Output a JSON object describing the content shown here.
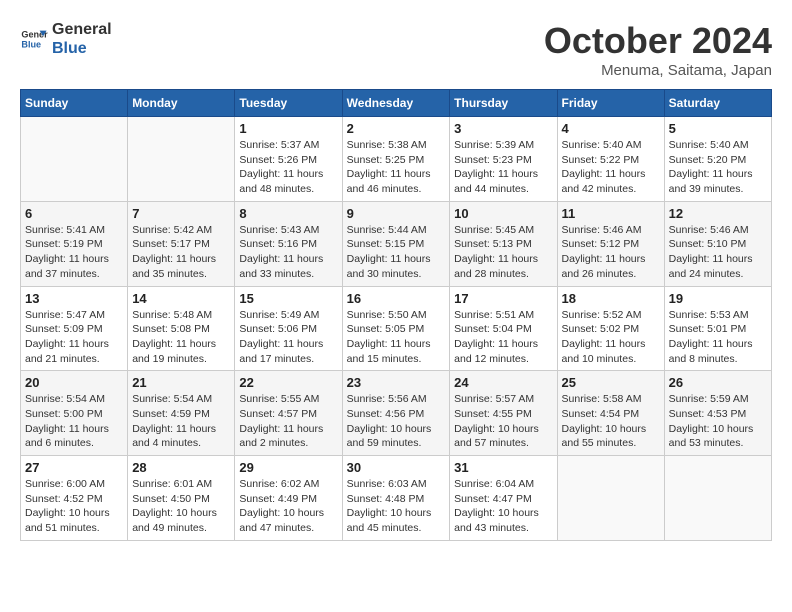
{
  "logo": {
    "line1": "General",
    "line2": "Blue"
  },
  "title": "October 2024",
  "subtitle": "Menuma, Saitama, Japan",
  "headers": [
    "Sunday",
    "Monday",
    "Tuesday",
    "Wednesday",
    "Thursday",
    "Friday",
    "Saturday"
  ],
  "weeks": [
    [
      {
        "day": "",
        "detail": ""
      },
      {
        "day": "",
        "detail": ""
      },
      {
        "day": "1",
        "detail": "Sunrise: 5:37 AM\nSunset: 5:26 PM\nDaylight: 11 hours and 48 minutes."
      },
      {
        "day": "2",
        "detail": "Sunrise: 5:38 AM\nSunset: 5:25 PM\nDaylight: 11 hours and 46 minutes."
      },
      {
        "day": "3",
        "detail": "Sunrise: 5:39 AM\nSunset: 5:23 PM\nDaylight: 11 hours and 44 minutes."
      },
      {
        "day": "4",
        "detail": "Sunrise: 5:40 AM\nSunset: 5:22 PM\nDaylight: 11 hours and 42 minutes."
      },
      {
        "day": "5",
        "detail": "Sunrise: 5:40 AM\nSunset: 5:20 PM\nDaylight: 11 hours and 39 minutes."
      }
    ],
    [
      {
        "day": "6",
        "detail": "Sunrise: 5:41 AM\nSunset: 5:19 PM\nDaylight: 11 hours and 37 minutes."
      },
      {
        "day": "7",
        "detail": "Sunrise: 5:42 AM\nSunset: 5:17 PM\nDaylight: 11 hours and 35 minutes."
      },
      {
        "day": "8",
        "detail": "Sunrise: 5:43 AM\nSunset: 5:16 PM\nDaylight: 11 hours and 33 minutes."
      },
      {
        "day": "9",
        "detail": "Sunrise: 5:44 AM\nSunset: 5:15 PM\nDaylight: 11 hours and 30 minutes."
      },
      {
        "day": "10",
        "detail": "Sunrise: 5:45 AM\nSunset: 5:13 PM\nDaylight: 11 hours and 28 minutes."
      },
      {
        "day": "11",
        "detail": "Sunrise: 5:46 AM\nSunset: 5:12 PM\nDaylight: 11 hours and 26 minutes."
      },
      {
        "day": "12",
        "detail": "Sunrise: 5:46 AM\nSunset: 5:10 PM\nDaylight: 11 hours and 24 minutes."
      }
    ],
    [
      {
        "day": "13",
        "detail": "Sunrise: 5:47 AM\nSunset: 5:09 PM\nDaylight: 11 hours and 21 minutes."
      },
      {
        "day": "14",
        "detail": "Sunrise: 5:48 AM\nSunset: 5:08 PM\nDaylight: 11 hours and 19 minutes."
      },
      {
        "day": "15",
        "detail": "Sunrise: 5:49 AM\nSunset: 5:06 PM\nDaylight: 11 hours and 17 minutes."
      },
      {
        "day": "16",
        "detail": "Sunrise: 5:50 AM\nSunset: 5:05 PM\nDaylight: 11 hours and 15 minutes."
      },
      {
        "day": "17",
        "detail": "Sunrise: 5:51 AM\nSunset: 5:04 PM\nDaylight: 11 hours and 12 minutes."
      },
      {
        "day": "18",
        "detail": "Sunrise: 5:52 AM\nSunset: 5:02 PM\nDaylight: 11 hours and 10 minutes."
      },
      {
        "day": "19",
        "detail": "Sunrise: 5:53 AM\nSunset: 5:01 PM\nDaylight: 11 hours and 8 minutes."
      }
    ],
    [
      {
        "day": "20",
        "detail": "Sunrise: 5:54 AM\nSunset: 5:00 PM\nDaylight: 11 hours and 6 minutes."
      },
      {
        "day": "21",
        "detail": "Sunrise: 5:54 AM\nSunset: 4:59 PM\nDaylight: 11 hours and 4 minutes."
      },
      {
        "day": "22",
        "detail": "Sunrise: 5:55 AM\nSunset: 4:57 PM\nDaylight: 11 hours and 2 minutes."
      },
      {
        "day": "23",
        "detail": "Sunrise: 5:56 AM\nSunset: 4:56 PM\nDaylight: 10 hours and 59 minutes."
      },
      {
        "day": "24",
        "detail": "Sunrise: 5:57 AM\nSunset: 4:55 PM\nDaylight: 10 hours and 57 minutes."
      },
      {
        "day": "25",
        "detail": "Sunrise: 5:58 AM\nSunset: 4:54 PM\nDaylight: 10 hours and 55 minutes."
      },
      {
        "day": "26",
        "detail": "Sunrise: 5:59 AM\nSunset: 4:53 PM\nDaylight: 10 hours and 53 minutes."
      }
    ],
    [
      {
        "day": "27",
        "detail": "Sunrise: 6:00 AM\nSunset: 4:52 PM\nDaylight: 10 hours and 51 minutes."
      },
      {
        "day": "28",
        "detail": "Sunrise: 6:01 AM\nSunset: 4:50 PM\nDaylight: 10 hours and 49 minutes."
      },
      {
        "day": "29",
        "detail": "Sunrise: 6:02 AM\nSunset: 4:49 PM\nDaylight: 10 hours and 47 minutes."
      },
      {
        "day": "30",
        "detail": "Sunrise: 6:03 AM\nSunset: 4:48 PM\nDaylight: 10 hours and 45 minutes."
      },
      {
        "day": "31",
        "detail": "Sunrise: 6:04 AM\nSunset: 4:47 PM\nDaylight: 10 hours and 43 minutes."
      },
      {
        "day": "",
        "detail": ""
      },
      {
        "day": "",
        "detail": ""
      }
    ]
  ]
}
